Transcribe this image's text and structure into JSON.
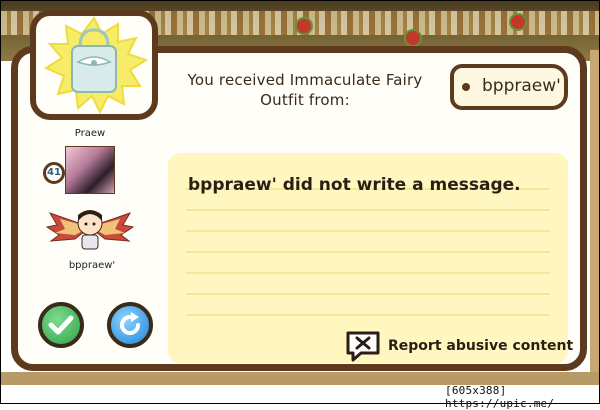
{
  "dialog": {
    "received_line": "You received Immaculate Fairy Outfit from:",
    "sender_tag": "bppraew'",
    "message": "bppraew' did not write a message.",
    "report_label": "Report abusive content"
  },
  "sender": {
    "name": "Praew",
    "level": "41"
  },
  "receiver": {
    "name": "bppraew'"
  },
  "watermark": "[605x388] https://upic.me/",
  "colors": {
    "frame": "#5d3a1e",
    "paper": "#fffef9",
    "note": "#fff7bf",
    "ok_button": "#2fa34a",
    "refresh_button": "#1e84d6"
  }
}
